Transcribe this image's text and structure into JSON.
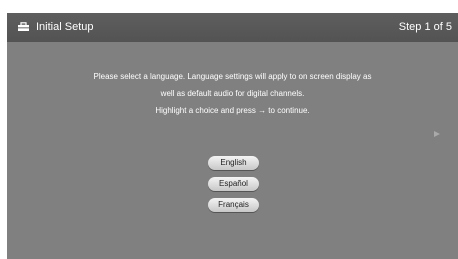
{
  "header": {
    "title": "Initial Setup",
    "step": "Step 1 of 5",
    "icon": "toolbox-icon"
  },
  "instructions": {
    "line1": "Please select a language. Language settings will apply to on screen display as",
    "line2": "well as default audio for digital channels.",
    "line3": "Highlight a choice and press → to continue."
  },
  "languages": [
    {
      "label": "English"
    },
    {
      "label": "Español"
    },
    {
      "label": "Français"
    }
  ],
  "nav": {
    "next_icon": "right-arrow-icon"
  },
  "colors": {
    "background": "#808080",
    "title_bar": "#555555",
    "text": "#ffffff",
    "button": "#dcdcdc"
  }
}
